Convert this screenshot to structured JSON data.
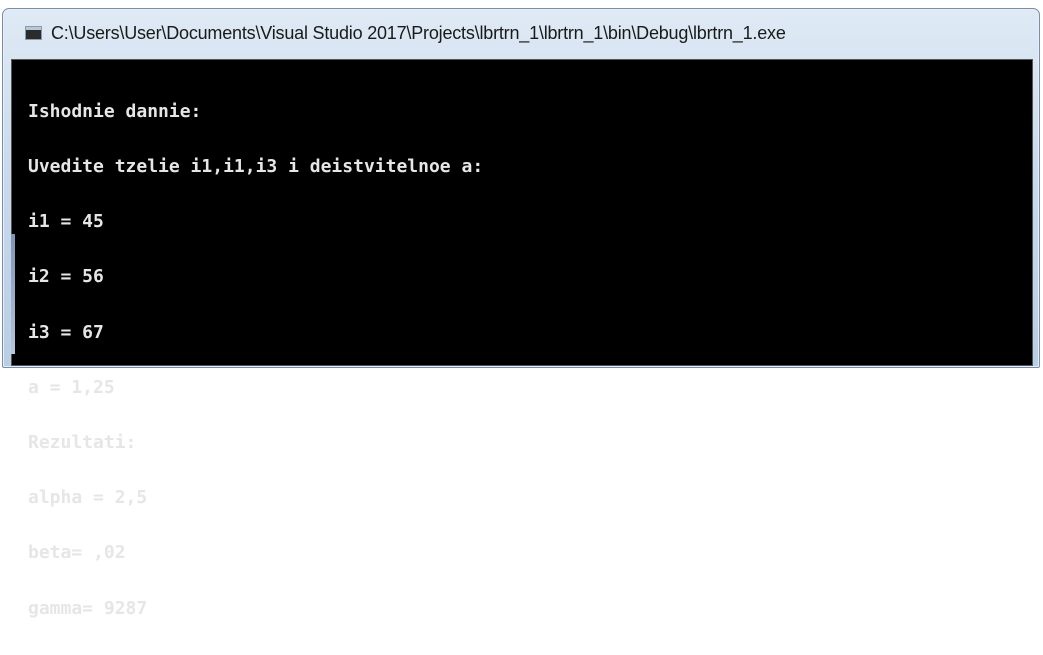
{
  "window": {
    "title": "C:\\Users\\User\\Documents\\Visual Studio 2017\\Projects\\lbrtrn_1\\lbrtrn_1\\bin\\Debug\\lbrtrn_1.exe",
    "icon": "console-app-icon"
  },
  "console": {
    "background": "#000000",
    "foreground": "#e6e6e6",
    "lines": [
      "Ishodnie dannie:",
      "Uvedite tzelie i1,i1,i3 i deistvitelnoe a:",
      "i1 = 45",
      "i2 = 56",
      "i3 = 67",
      "a = 1,25",
      "Rezultati:",
      "alpha = 2,5",
      "beta= ,02",
      "gamma= 9287"
    ]
  }
}
